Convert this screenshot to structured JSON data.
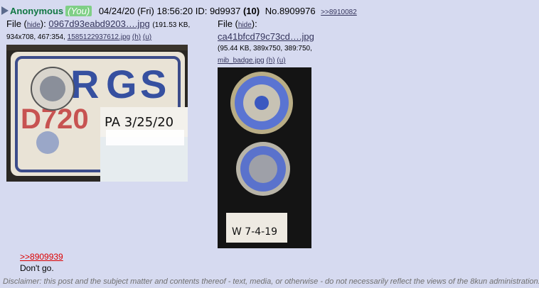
{
  "post": {
    "name": "Anonymous",
    "you_label": "(You)",
    "datetime": "04/24/20 (Fri) 18:56:20",
    "id_label": "ID:",
    "id_value": "9d9937",
    "reply_count": "(10)",
    "number_label": "No.8909976",
    "backlink": ">>8910082",
    "quote_link": ">>8909939",
    "body_text": "Don't go."
  },
  "files": [
    {
      "file_label": "File (",
      "hide_label": "hide",
      "close_paren": "):",
      "filename": "0967d93eabd9203….jpg",
      "size_line1": "(191.53 KB,",
      "meta_line2": "934x708, 467:354,",
      "orig_name": "1585122937612.jpg",
      "h_label": "(h)",
      "u_label": "(u)",
      "handwriting": "PA 3/25/20"
    },
    {
      "file_label": "File (",
      "hide_label": "hide",
      "close_paren": "):",
      "filename": "ca41bfcd79c73cd….jpg",
      "size_line1": "(95.44 KB, 389x750, 389:750,",
      "orig_name": "mib_badge.jpg",
      "h_label": "(h)",
      "u_label": "(u)",
      "handwriting": "W 7-4-19"
    }
  ],
  "disclaimer": "Disclaimer: this post and the subject matter and contents thereof - text, media, or otherwise - do not necessarily reflect the views of the 8kun administration.",
  "colors": {
    "background": "#d6daf0",
    "name": "#117743",
    "link": "#34345c",
    "quote": "#dd0000"
  }
}
